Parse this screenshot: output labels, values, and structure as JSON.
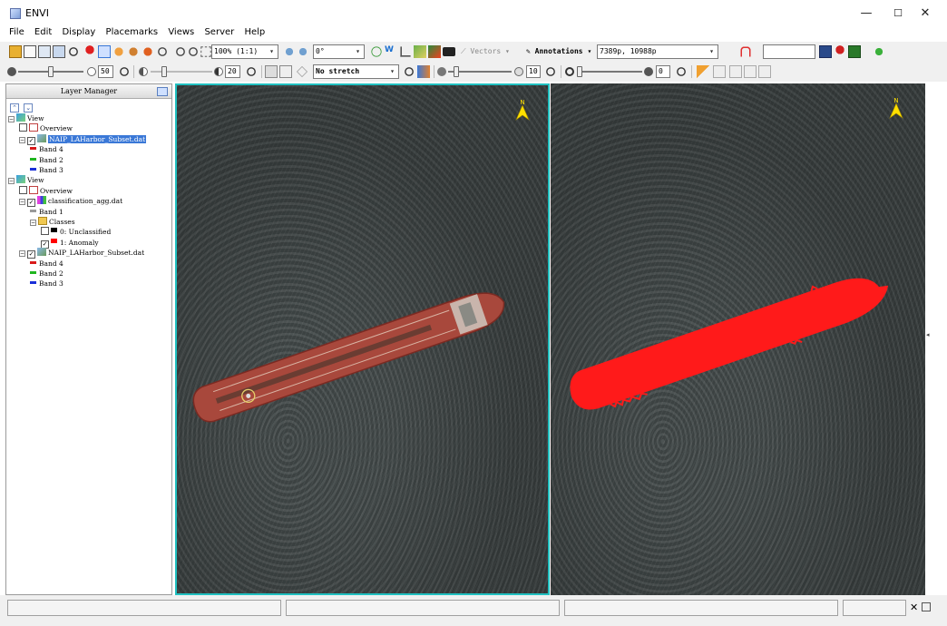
{
  "window": {
    "title": "ENVI",
    "controls": {
      "minimize": "—",
      "maximize": "☐",
      "close": "✕"
    }
  },
  "menu": [
    "File",
    "Edit",
    "Display",
    "Placemarks",
    "Views",
    "Server",
    "Help"
  ],
  "toolbar1": {
    "zoom_value": "100% (1:1)",
    "rotation_value": "0°",
    "vectors_label": "Vectors",
    "annotations_label": "Annotations",
    "location_value": "7389p, 10988p",
    "search_value": ""
  },
  "toolbar2": {
    "brightness": {
      "value": "50",
      "level": 0.5
    },
    "contrast": {
      "value": "20",
      "level": 0.2
    },
    "stretch_value": "No stretch",
    "sharpen": {
      "value": "10",
      "level": 0.1
    },
    "transparency": {
      "value": "0",
      "level": 0.0
    }
  },
  "layer_manager": {
    "title": "Layer Manager",
    "tree": [
      {
        "label": "View",
        "level": 0,
        "kind": "view",
        "toggle": "⊟"
      },
      {
        "label": "Overview",
        "level": 1,
        "kind": "overview",
        "checked": false
      },
      {
        "label": "NAIP_LAHarbor_Subset.dat",
        "level": 1,
        "kind": "raster",
        "checked": true,
        "selected": true,
        "toggle": "⊟"
      },
      {
        "label": "Band 4",
        "level": 2,
        "kind": "band",
        "color": "#d81a1a"
      },
      {
        "label": "Band 2",
        "level": 2,
        "kind": "band",
        "color": "#1fb51f"
      },
      {
        "label": "Band 3",
        "level": 2,
        "kind": "band",
        "color": "#1a2fd8"
      },
      {
        "label": "View",
        "level": 0,
        "kind": "view",
        "toggle": "⊟"
      },
      {
        "label": "Overview",
        "level": 1,
        "kind": "overview",
        "checked": false
      },
      {
        "label": "classification_agg.dat",
        "level": 1,
        "kind": "classification",
        "checked": true,
        "toggle": "⊟"
      },
      {
        "label": "Band 1",
        "level": 2,
        "kind": "grayband",
        "color": "#9a9a9a"
      },
      {
        "label": "Classes",
        "level": 2,
        "kind": "folder",
        "toggle": "⊟"
      },
      {
        "label": "0: Unclassified",
        "level": 3,
        "kind": "class",
        "checked": false,
        "color": "#000000"
      },
      {
        "label": "1: Anomaly",
        "level": 3,
        "kind": "class",
        "checked": true,
        "color": "#ff0000"
      },
      {
        "label": "NAIP_LAHarbor_Subset.dat",
        "level": 1,
        "kind": "raster",
        "checked": true,
        "toggle": "⊟"
      },
      {
        "label": "Band 4",
        "level": 2,
        "kind": "band",
        "color": "#d81a1a"
      },
      {
        "label": "Band 2",
        "level": 2,
        "kind": "band",
        "color": "#1fb51f"
      },
      {
        "label": "Band 3",
        "level": 2,
        "kind": "band",
        "color": "#1a2fd8"
      }
    ]
  },
  "views": {
    "north_label": "N",
    "accent": "#20c0c0",
    "anomaly_color": "#ff0000",
    "ship_color": "#a8483c"
  },
  "statusbar": {
    "fields": [
      "",
      "",
      "",
      ""
    ],
    "close_label": "✕"
  }
}
